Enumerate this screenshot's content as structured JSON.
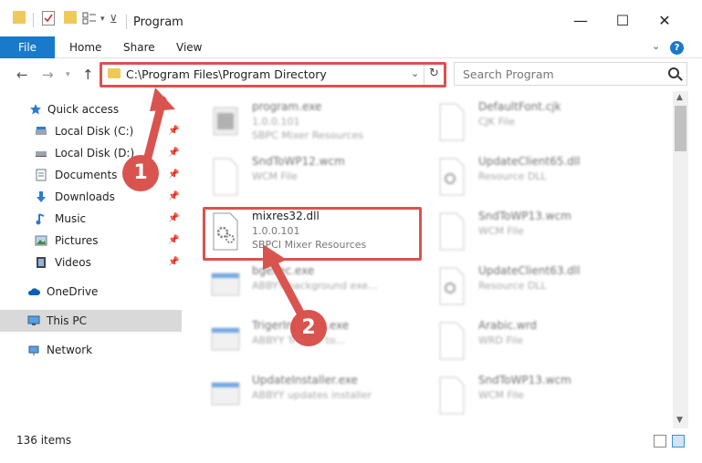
{
  "window": {
    "title": "Program",
    "minimize": "—",
    "maximize": "☐",
    "close": "✕"
  },
  "ribbon": {
    "tabs": [
      "File",
      "Home",
      "Share",
      "View"
    ],
    "help": "?"
  },
  "nav": {
    "back": "←",
    "forward": "→",
    "up": "↑",
    "address": "C:\\Program Files\\Program Directory",
    "refresh": "↻",
    "search_placeholder": "Search Program"
  },
  "sidebar": {
    "items": [
      {
        "label": "Quick access",
        "icon": "star-icon",
        "pinned": false
      },
      {
        "label": "Local Disk (C:)",
        "icon": "drive-icon",
        "pinned": true
      },
      {
        "label": "Local Disk (D:)",
        "icon": "drive-icon",
        "pinned": true
      },
      {
        "label": "Documents",
        "icon": "documents-icon",
        "pinned": true
      },
      {
        "label": "Downloads",
        "icon": "download-icon",
        "pinned": true
      },
      {
        "label": "Music",
        "icon": "music-icon",
        "pinned": true
      },
      {
        "label": "Pictures",
        "icon": "pictures-icon",
        "pinned": true
      },
      {
        "label": "Videos",
        "icon": "videos-icon",
        "pinned": true
      },
      {
        "label": "OneDrive",
        "icon": "cloud-icon",
        "pinned": false
      },
      {
        "label": "This PC",
        "icon": "pc-icon",
        "pinned": false
      },
      {
        "label": "Network",
        "icon": "network-icon",
        "pinned": false
      }
    ]
  },
  "files": {
    "left": [
      {
        "name": "program.exe",
        "l1": "1.0.0.101",
        "l2": "SBPC Mixer Resources",
        "blurred": true
      },
      {
        "name": "SndToWP12.wcm",
        "l1": "WCM File",
        "l2": "",
        "blurred": true
      },
      {
        "name": "mixres32.dll",
        "l1": "1.0.0.101",
        "l2": "SBPCI Mixer Resources",
        "blurred": false
      },
      {
        "name": "bgexec.exe",
        "l1": "ABBYY background exe...",
        "l2": "",
        "blurred": true
      },
      {
        "name": "TrigerInstaller.exe",
        "l1": "ABBYY Trigger to...",
        "l2": "",
        "blurred": true
      },
      {
        "name": "UpdateInstaller.exe",
        "l1": "ABBYY updates installer",
        "l2": "",
        "blurred": true
      }
    ],
    "right": [
      {
        "name": "DefaultFont.cjk",
        "l1": "CJK File",
        "l2": ""
      },
      {
        "name": "UpdateClient65.dll",
        "l1": "Resource DLL",
        "l2": ""
      },
      {
        "name": "SndToWP13.wcm",
        "l1": "WCM File",
        "l2": ""
      },
      {
        "name": "UpdateClient63.dll",
        "l1": "Resource DLL",
        "l2": ""
      },
      {
        "name": "Arabic.wrd",
        "l1": "WRD File",
        "l2": ""
      },
      {
        "name": "SndToWP13.wcm",
        "l1": "WCM File",
        "l2": ""
      }
    ]
  },
  "status": {
    "count": "136 items"
  },
  "annotations": {
    "step1": "1",
    "step2": "2",
    "accent": "#d9534f"
  }
}
